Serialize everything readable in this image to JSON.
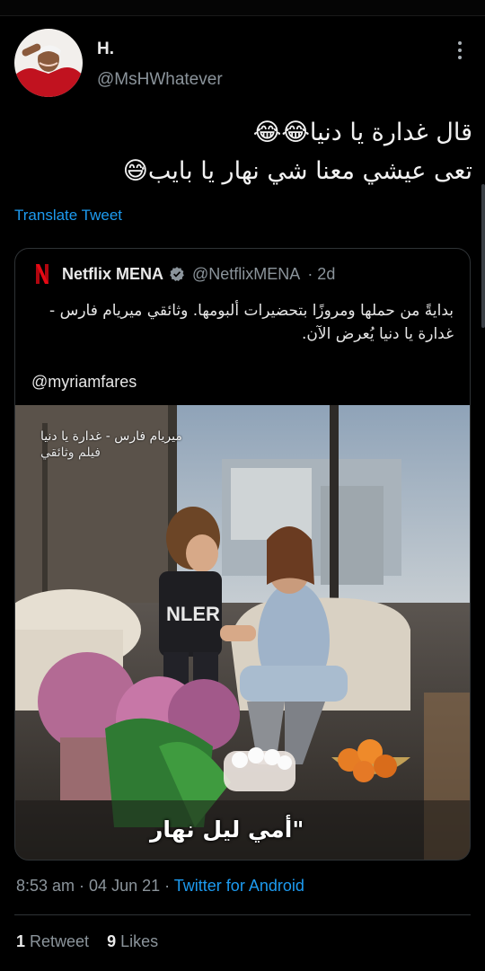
{
  "author": {
    "name": "H.",
    "handle": "@MsHWhatever"
  },
  "tweet": {
    "line1": "قال غدارة يا دنيا😂😂",
    "line2": "تعى عيشي معنا شي نهار يا بايب😅",
    "translate_label": "Translate Tweet"
  },
  "quoted": {
    "name": "Netflix MENA",
    "handle": "@NetflixMENA",
    "age": "· 2d",
    "text": "بدايةً من حملها ومروزًا بتحضيرات ألبومها. وثائقي ميريام فارس - غدارة يا دنيا يُعرض الآن.",
    "mention": "@myriamfares",
    "overlay_title": "ميريام فارس - غدارة يا دنيا",
    "overlay_sub": "فيلم وثائقي",
    "caption": "\"أمي ليل نهار"
  },
  "meta": {
    "time": "8:53 am",
    "sep1": " · ",
    "date": "04 Jun 21",
    "sep2": " · ",
    "source": "Twitter for Android"
  },
  "stats": {
    "retweets_count": "1",
    "retweets_label": " Retweet",
    "likes_count": "9",
    "likes_label": " Likes"
  },
  "colors": {
    "background": "#000000",
    "link": "#1d9bf0",
    "muted": "#8b949b",
    "netflix_red": "#e50914",
    "verified": "#8b949b"
  },
  "icons": [
    "more-vertical-icon",
    "netflix-logo-icon",
    "verified-badge-icon"
  ]
}
